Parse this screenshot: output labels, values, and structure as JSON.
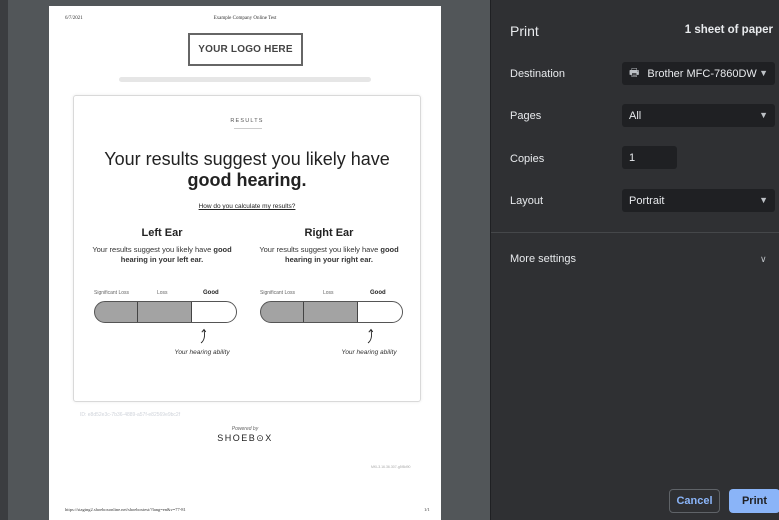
{
  "preview": {
    "header_date": "6/7/2021",
    "header_title": "Example Company Online Test",
    "logo_text": "YOUR LOGO HERE",
    "results_label": "RESULTS",
    "headline_line1": "Your results suggest you likely have",
    "headline_line2": "good hearing.",
    "calc_link": "How do you calculate my results?",
    "left_ear": {
      "title": "Left Ear",
      "desc_pre": "Your results suggest you likely have ",
      "desc_bold": "good hearing in your left ear."
    },
    "right_ear": {
      "title": "Right Ear",
      "desc_pre": "Your results suggest you likely have ",
      "desc_bold": "good hearing in your right ear."
    },
    "scale": {
      "significant_loss": "Significant Loss",
      "loss": "Loss",
      "good": "Good"
    },
    "ability_label": "Your hearing ability",
    "id_text": "ID: e8d52e3c-7b36-4889-a57f-e82569e9bc2f",
    "powered_by": "Powered by",
    "brand": "SHOEB⊙X",
    "version": "MKL3.16.36.307-g5f8d90",
    "footer_url": "https://staging2.shoeboxonline.net/shoeboxtest/?lang=en&v=77-81",
    "footer_page": "1/1"
  },
  "panel": {
    "title": "Print",
    "sheets": "1 sheet of paper",
    "destination_label": "Destination",
    "destination_value": "Brother MFC-7860DW",
    "pages_label": "Pages",
    "pages_value": "All",
    "copies_label": "Copies",
    "copies_value": "1",
    "layout_label": "Layout",
    "layout_value": "Portrait",
    "more_settings": "More settings",
    "cancel": "Cancel",
    "print": "Print"
  },
  "colors": {
    "panel_bg": "#2f3033",
    "accent": "#8ab4f8",
    "preview_bg": "#525659"
  }
}
